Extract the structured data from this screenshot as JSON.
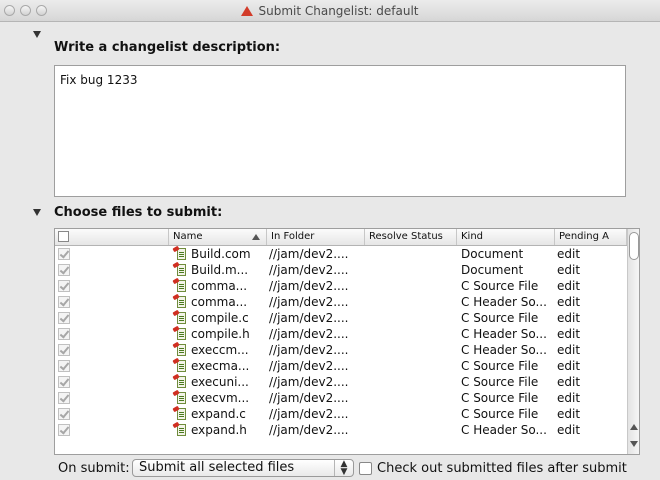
{
  "window": {
    "title": "Submit Changelist: default"
  },
  "description_section": {
    "heading": "Write a changelist description:",
    "text": "Fix bug 1233"
  },
  "files_section": {
    "heading": "Choose files to submit:",
    "columns": [
      "",
      "Name",
      "In Folder",
      "Resolve Status",
      "Kind",
      "Pending A"
    ],
    "rows": [
      {
        "name": "Build.com",
        "folder": "//jam/dev2....",
        "resolve": "",
        "kind": "Document",
        "pending": "edit"
      },
      {
        "name": "Build.m...",
        "folder": "//jam/dev2....",
        "resolve": "",
        "kind": "Document",
        "pending": "edit"
      },
      {
        "name": "comma...",
        "folder": "//jam/dev2....",
        "resolve": "",
        "kind": "C Source File",
        "pending": "edit"
      },
      {
        "name": "comma...",
        "folder": "//jam/dev2....",
        "resolve": "",
        "kind": "C Header So...",
        "pending": "edit"
      },
      {
        "name": "compile.c",
        "folder": "//jam/dev2....",
        "resolve": "",
        "kind": "C Source File",
        "pending": "edit"
      },
      {
        "name": "compile.h",
        "folder": "//jam/dev2....",
        "resolve": "",
        "kind": "C Header So...",
        "pending": "edit"
      },
      {
        "name": "execcm...",
        "folder": "//jam/dev2....",
        "resolve": "",
        "kind": "C Header So...",
        "pending": "edit"
      },
      {
        "name": "execma...",
        "folder": "//jam/dev2....",
        "resolve": "",
        "kind": "C Source File",
        "pending": "edit"
      },
      {
        "name": "execuni...",
        "folder": "//jam/dev2....",
        "resolve": "",
        "kind": "C Source File",
        "pending": "edit"
      },
      {
        "name": "execvm...",
        "folder": "//jam/dev2....",
        "resolve": "",
        "kind": "C Source File",
        "pending": "edit"
      },
      {
        "name": "expand.c",
        "folder": "//jam/dev2....",
        "resolve": "",
        "kind": "C Source File",
        "pending": "edit"
      },
      {
        "name": "expand.h",
        "folder": "//jam/dev2....",
        "resolve": "",
        "kind": "C Header So...",
        "pending": "edit"
      }
    ]
  },
  "footer": {
    "on_submit_label": "On submit:",
    "on_submit_value": "Submit all selected files",
    "checkout_label": "Check out submitted files after submit"
  },
  "icons": {
    "title": "warning-icon",
    "file": "source-file-icon"
  },
  "colors": {
    "warning": "#d23c2a",
    "window_bg": "#e8e8e8"
  }
}
